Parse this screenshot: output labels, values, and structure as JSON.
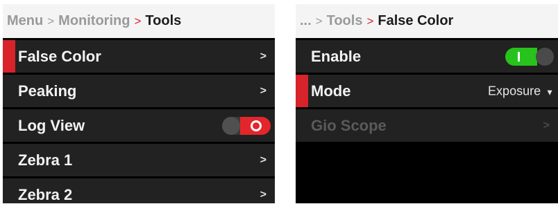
{
  "left": {
    "breadcrumb": {
      "root": "Menu",
      "parent": "Monitoring",
      "current": "Tools",
      "sep": ">"
    },
    "items": [
      {
        "label": "False Color",
        "chevron": ">"
      },
      {
        "label": "Peaking",
        "chevron": ">"
      },
      {
        "label": "Log View",
        "toggle": "off"
      },
      {
        "label": "Zebra 1",
        "chevron": ">"
      },
      {
        "label": "Zebra 2",
        "chevron": ">"
      }
    ]
  },
  "right": {
    "breadcrumb": {
      "ellipsis": "...",
      "parent": "Tools",
      "current": "False Color",
      "sep": ">"
    },
    "items": [
      {
        "label": "Enable",
        "toggle": "on"
      },
      {
        "label": "Mode",
        "value": "Exposure",
        "caret": "▼"
      },
      {
        "label": "Gio Scope",
        "chevron": ">",
        "disabled": true
      }
    ]
  },
  "colors": {
    "accent": "#d8232a",
    "on": "#27c21c",
    "off": "#e2262b"
  }
}
